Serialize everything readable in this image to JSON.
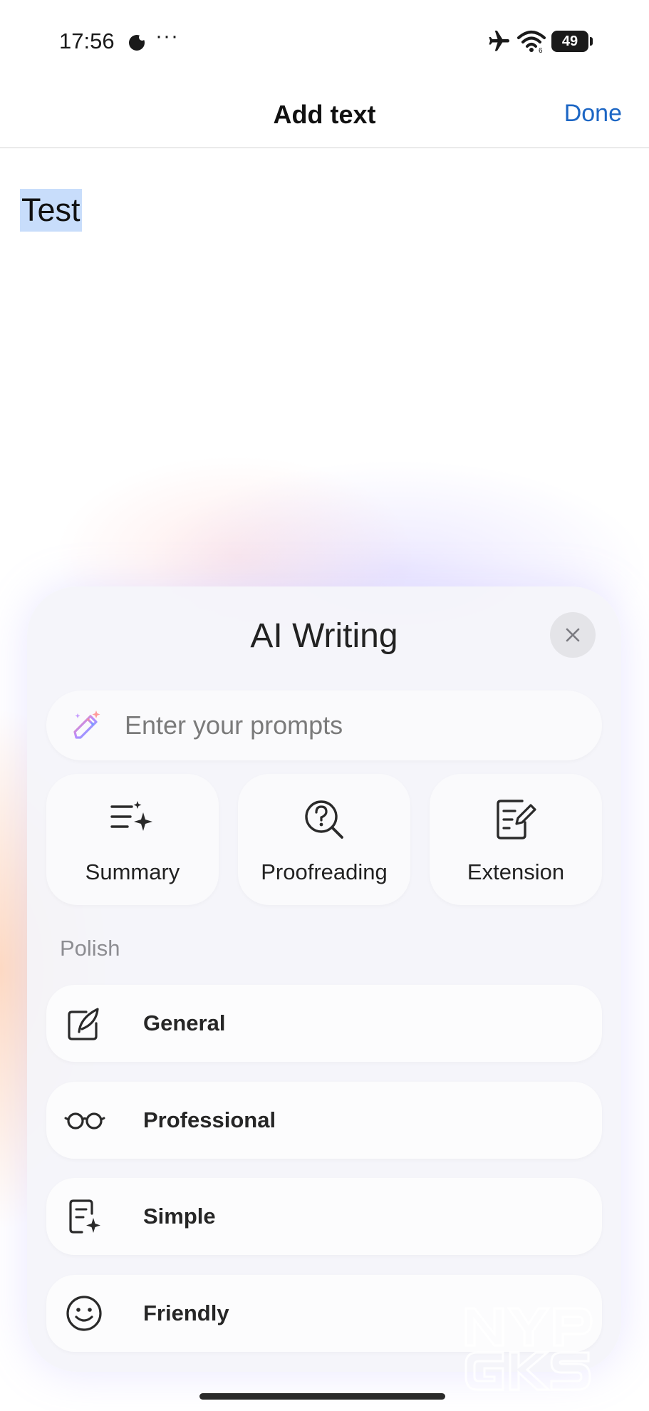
{
  "status_bar": {
    "time": "17:56",
    "more": "···",
    "battery_level": "49"
  },
  "header": {
    "title": "Add text",
    "done_label": "Done"
  },
  "editor": {
    "text": "Test",
    "selection_color": "#c8ddfb"
  },
  "ai_panel": {
    "title": "AI Writing",
    "close_icon": "close-icon",
    "prompt": {
      "value": "",
      "placeholder": "Enter your prompts",
      "icon": "magic-pen-icon"
    },
    "tools": [
      {
        "label": "Summary",
        "icon": "summary-sparkle-icon"
      },
      {
        "label": "Proofreading",
        "icon": "question-magnifier-icon"
      },
      {
        "label": "Extension",
        "icon": "edit-document-icon"
      }
    ],
    "polish": {
      "section_label": "Polish",
      "items": [
        {
          "label": "General",
          "icon": "quill-card-icon"
        },
        {
          "label": "Professional",
          "icon": "glasses-icon"
        },
        {
          "label": "Simple",
          "icon": "document-sparkle-icon"
        },
        {
          "label": "Friendly",
          "icon": "smiley-icon"
        }
      ]
    }
  },
  "colors": {
    "accent": "#1c66c4",
    "panel_background": "#f4f4fa"
  }
}
